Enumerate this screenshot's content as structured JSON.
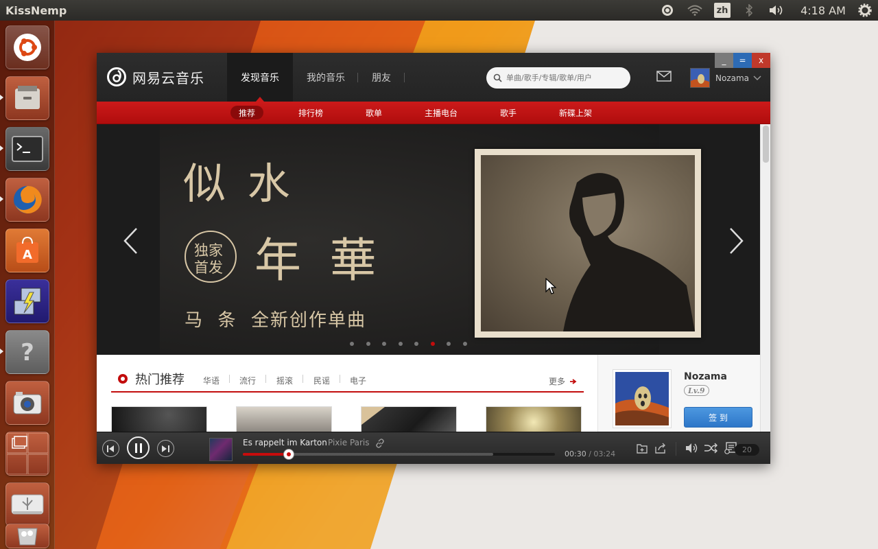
{
  "topbar": {
    "app_name": "KissNemp",
    "ime": "zh",
    "clock": "4:18 AM"
  },
  "launcher": {
    "items": [
      "ubuntu-dash",
      "files",
      "terminal",
      "firefox",
      "software-center",
      "remote-desktop",
      "help",
      "cheese-camera",
      "workspace-switcher",
      "usb-drive",
      "trash"
    ]
  },
  "app": {
    "logo_text": "网易云音乐",
    "nav": [
      "发现音乐",
      "我的音乐",
      "朋友"
    ],
    "search_placeholder": "单曲/歌手/专辑/歌单/用户",
    "user_name": "Nozama",
    "window_buttons": [
      "_",
      "=",
      "x"
    ],
    "subnav": [
      "推荐",
      "排行榜",
      "歌单",
      "主播电台",
      "歌手",
      "新碟上架"
    ],
    "subnav_active": "推荐"
  },
  "banner": {
    "line1": "似 水",
    "badge_line1": "独家",
    "badge_line2": "首发",
    "line2": "年 華",
    "line3": "马  条  全新创作单曲",
    "dot_count": 8,
    "active_dot": 6
  },
  "hot": {
    "title": "热门推荐",
    "tags": [
      "华语",
      "流行",
      "摇滚",
      "民谣",
      "电子"
    ],
    "more": "更多"
  },
  "profile": {
    "name": "Nozama",
    "level": "Lv.9",
    "checkin": "签 到"
  },
  "player": {
    "song": "Es rappelt im Karton",
    "artist": "Pixie Paris",
    "elapsed": "00:30",
    "total": "03:24",
    "progress_fraction": 0.147,
    "buffered_fraction": 0.802,
    "playlist_count": "20"
  },
  "colors": {
    "accent": "#c20c0c",
    "header": "#2b2b2b",
    "button_blue": "#3584d4"
  }
}
